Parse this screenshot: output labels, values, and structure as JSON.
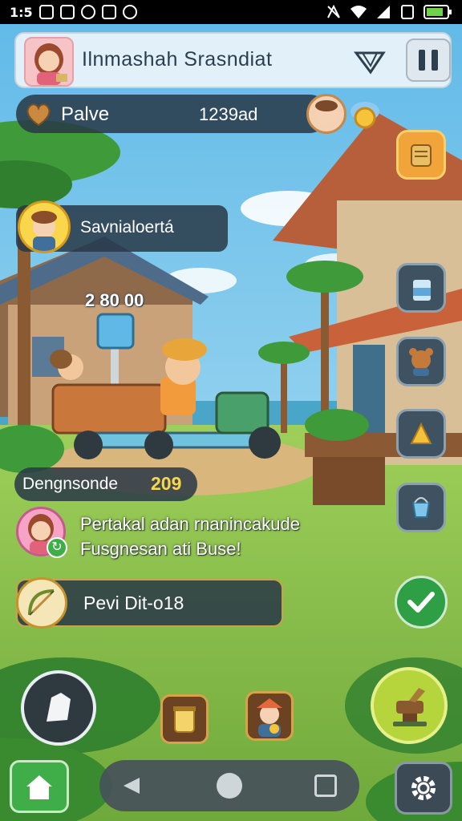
{
  "status_bar": {
    "time": "1:5"
  },
  "top_bar": {
    "title": "Ilnmashah Srasndiat"
  },
  "resources": {
    "label": "Palve",
    "value": "1239ad"
  },
  "quest": {
    "label": "Savnialoertá"
  },
  "floating_number": "2 80 00",
  "counter": {
    "label": "Dengnsonde",
    "value": "209"
  },
  "message": {
    "line1": "Pertakal adan rnanincakude",
    "line2": "Fusgnesan ati Buse!"
  },
  "task": {
    "label": "Pevi Dit-o18"
  },
  "colors": {
    "accent_green": "#3fae49",
    "panel_dark": "#283746",
    "gold": "#f7d84a"
  },
  "icons": {
    "top_left": "avatar-girl-icon",
    "map": "map-icon",
    "pause": "pause-icon",
    "resource": "heart-icon",
    "coin": "coin-icon",
    "side": [
      "scroll-icon",
      "milk-icon",
      "bear-icon",
      "cheese-icon",
      "bucket-icon"
    ],
    "check": "check-icon",
    "bottom": [
      "leaf-icon",
      "jar-icon",
      "boy-avatar-icon",
      "anvil-icon"
    ],
    "home": "home-icon",
    "settings": "gear-icon"
  }
}
